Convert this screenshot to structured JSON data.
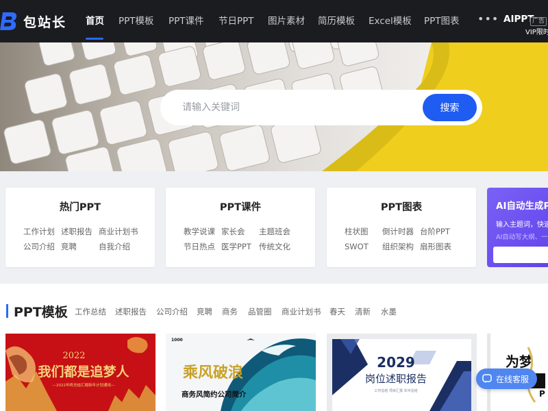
{
  "brand": {
    "name": "包站长"
  },
  "nav": {
    "items": [
      {
        "label": "首页",
        "active": true
      },
      {
        "label": "PPT模板"
      },
      {
        "label": "PPT课件"
      },
      {
        "label": "节日PPT"
      },
      {
        "label": "图片素材"
      },
      {
        "label": "简历模板"
      },
      {
        "label": "Excel模板"
      },
      {
        "label": "PPT图表"
      }
    ],
    "more_icon": "more-dots-icon",
    "aippt": "AIPPT",
    "ad_mark": "广告",
    "vip_tag": "VIP限时"
  },
  "search": {
    "placeholder": "请输入关键词",
    "value": "",
    "button": "搜索"
  },
  "cards": [
    {
      "title": "热门PPT",
      "links": [
        "工作计划",
        "述职报告",
        "商业计划书",
        "公司介绍",
        "竞聘",
        "自我介绍"
      ]
    },
    {
      "title": "PPT课件",
      "links": [
        "教学说课",
        "家长会",
        "主题班会",
        "节日热点",
        "医学PPT",
        "传统文化"
      ]
    },
    {
      "title": "PPT图表",
      "links": [
        "柱状图",
        "倒计时器",
        "台阶PPT",
        "SWOT",
        "组织架构",
        "扇形图表"
      ]
    }
  ],
  "ai_card": {
    "title": "AI自动生成PPT",
    "subtitle": "输入主题词，快速",
    "hint": "AI自动写大纲、一键"
  },
  "section": {
    "title": "PPT模板",
    "tags": [
      "工作总结",
      "述职报告",
      "公司介绍",
      "竞聘",
      "商务",
      "品管圈",
      "商业计划书",
      "春天",
      "清新",
      "水墨"
    ]
  },
  "thumbnails": [
    {
      "year": "2022",
      "headline": "我们都是追梦人",
      "sub": "—2022年终总结汇报新年计划通用—"
    },
    {
      "logo": "1000",
      "headline": "乘风破浪",
      "sub": "商务风简约公司简介"
    },
    {
      "year": "2029",
      "headline": "岗位述职报告",
      "sub": "工作总结 项目汇报 年中总结"
    },
    {
      "headline": "为梦"
    }
  ],
  "float_service": {
    "label": "在线客服",
    "icon": "chat-icon"
  },
  "colors": {
    "accent": "#1f5cf2",
    "nav_bg": "#1b1c20",
    "ai_purple": "#6b4ef0"
  }
}
